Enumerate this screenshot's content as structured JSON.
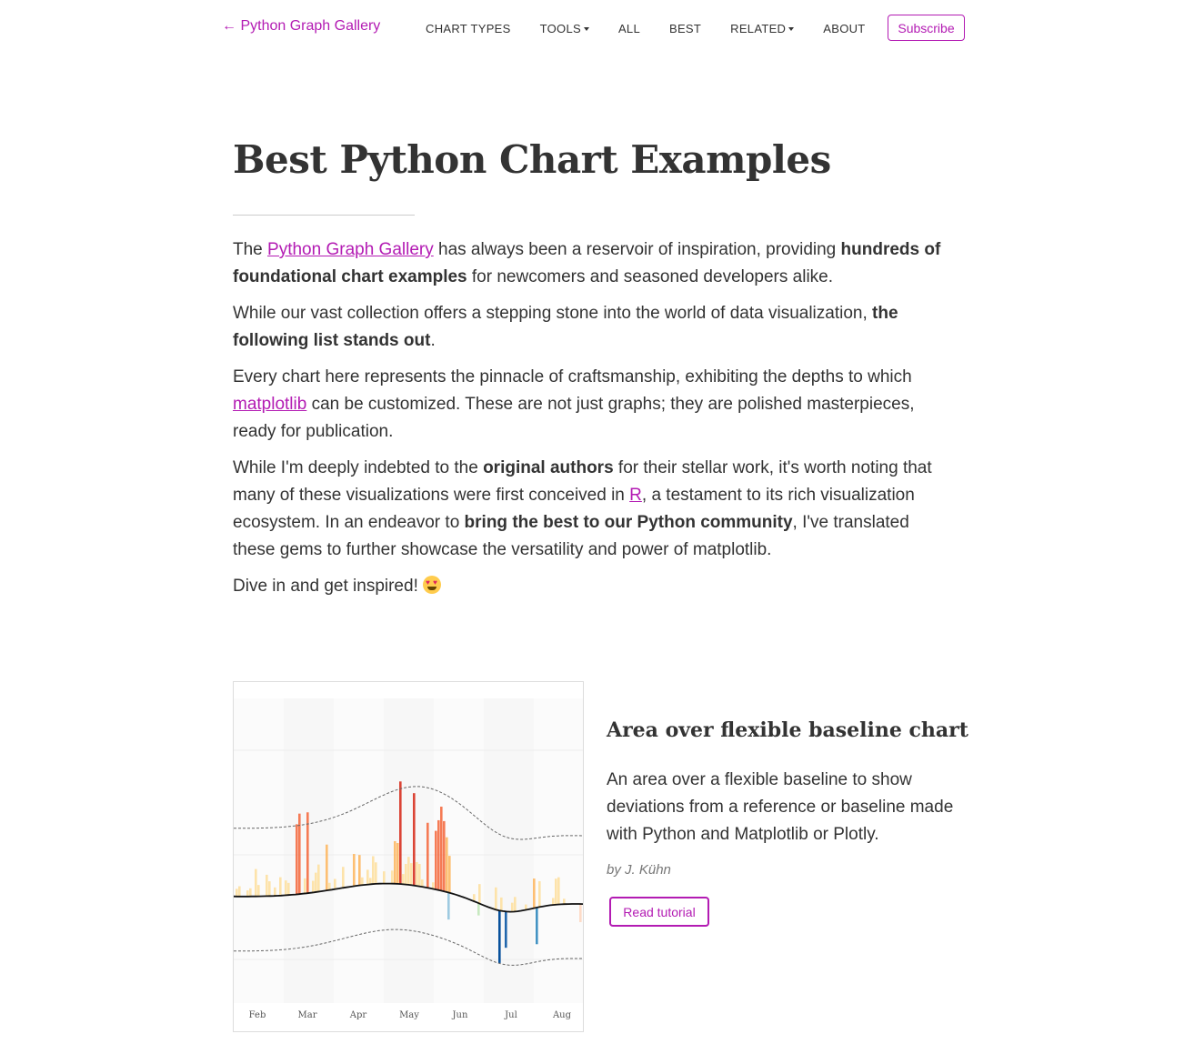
{
  "nav": {
    "brand": "← Python Graph Gallery",
    "links": [
      {
        "label": "CHART TYPES",
        "dropdown": false
      },
      {
        "label": "TOOLS",
        "dropdown": true
      },
      {
        "label": "ALL",
        "dropdown": false
      },
      {
        "label": "BEST",
        "dropdown": false
      },
      {
        "label": "RELATED",
        "dropdown": true
      },
      {
        "label": "ABOUT",
        "dropdown": false
      }
    ],
    "subscribe": "Subscribe"
  },
  "page": {
    "title": "Best Python Chart Examples",
    "p1": {
      "a": "The ",
      "link": "Python Graph Gallery",
      "b": " has always been a reservoir of inspiration, providing ",
      "bold": "hundreds of foundational chart examples",
      "c": " for newcomers and seasoned developers alike."
    },
    "p2": {
      "a": "While our vast collection offers a stepping stone into the world of data visualization, ",
      "bold": "the following list stands out",
      "b": "."
    },
    "p3": {
      "a": "Every chart here represents the pinnacle of craftsmanship, exhibiting the depths to which ",
      "link": "matplotlib",
      "b": " can be customized. These are not just graphs; they are polished masterpieces, ready for publication."
    },
    "p4": {
      "a": "While I'm deeply indebted to the ",
      "bold1": "original authors",
      "b": " for their stellar work, it's worth noting that many of these visualizations were first conceived in ",
      "link": "R",
      "c": ", a testament to its rich visualization ecosystem. In an endeavor to ",
      "bold2": "bring the best to our Python community",
      "d": ", I've translated these gems to further showcase the versatility and power of matplotlib."
    },
    "p5": {
      "a": "Dive in and get inspired! ",
      "emoji": "heart-eyes-emoji"
    }
  },
  "card": {
    "title": "Area over flexible baseline chart",
    "description": "An area over a flexible baseline to show deviations from a reference or baseline made with Python and Matplotlib or Plotly.",
    "author": "by J. Kühn",
    "button": "Read tutorial",
    "thumbnail": {
      "x_ticks": [
        "Feb",
        "Mar",
        "Apr",
        "May",
        "Jun",
        "Jul",
        "Aug"
      ],
      "colors": {
        "warm": "#d7301f",
        "cool": "#2166ac",
        "baseline": "#111111"
      }
    }
  },
  "colors": {
    "accent": "#b31bb3",
    "text": "#333333"
  }
}
